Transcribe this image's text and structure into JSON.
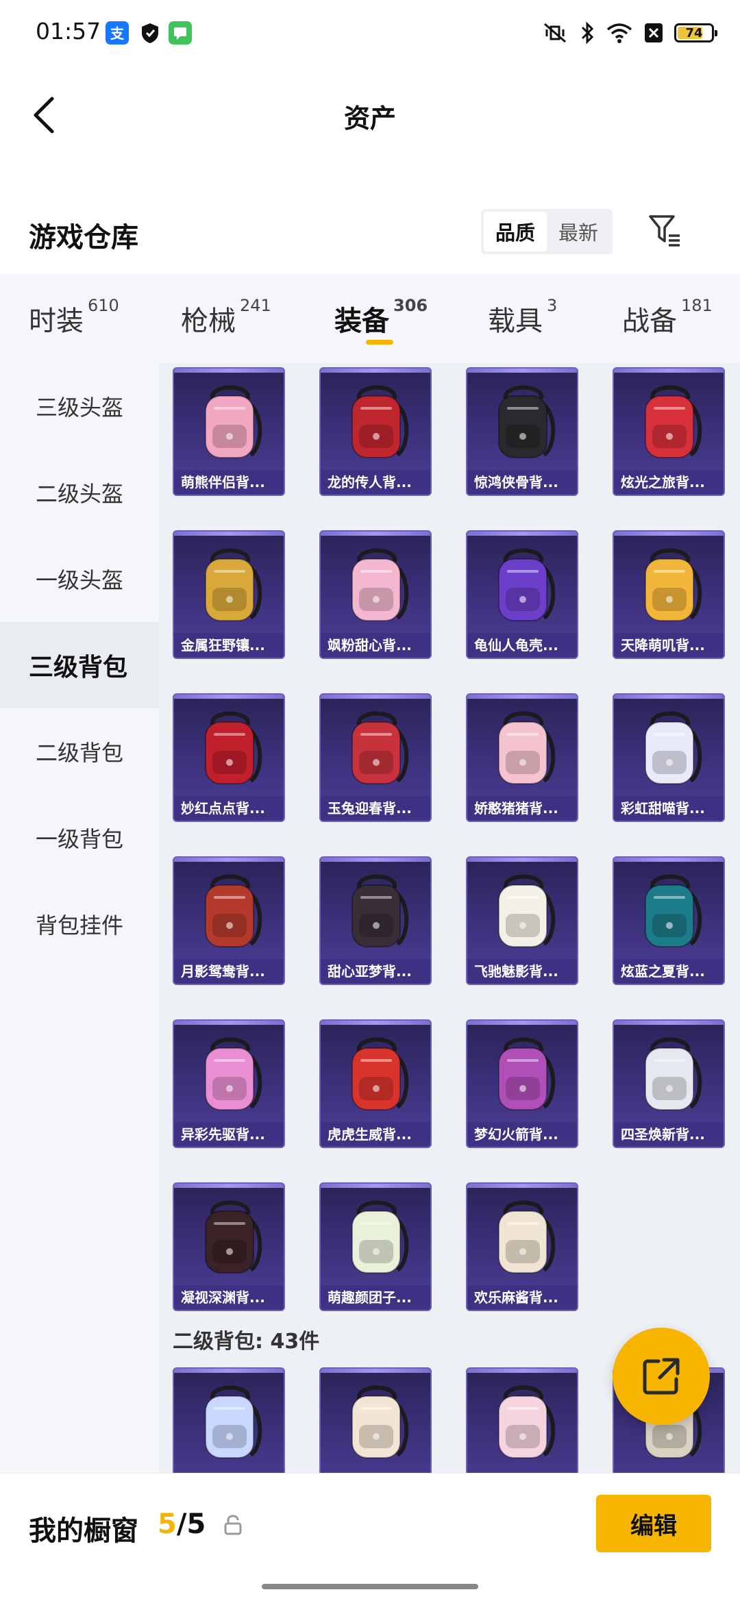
{
  "status_bar": {
    "time": "01:57",
    "battery": "74",
    "battery_level": 0.74
  },
  "header": {
    "title": "资产"
  },
  "warehouse": {
    "title": "游戏仓库",
    "sort_options": [
      "品质",
      "最新"
    ],
    "active_sort": "品质"
  },
  "tabs": [
    {
      "label": "时装",
      "count": "610"
    },
    {
      "label": "枪械",
      "count": "241"
    },
    {
      "label": "装备",
      "count": "306"
    },
    {
      "label": "载具",
      "count": "3"
    },
    {
      "label": "战备",
      "count": "181"
    }
  ],
  "active_tab": "装备",
  "categories": [
    "三级头盔",
    "二级头盔",
    "一级头盔",
    "三级背包",
    "二级背包",
    "一级背包",
    "背包挂件"
  ],
  "active_category": "三级背包",
  "items": [
    {
      "name": "萌熊伴侣背...",
      "icon": "bear-backpack-icon"
    },
    {
      "name": "龙的传人背...",
      "icon": "red-backpack-icon"
    },
    {
      "name": "惊鸿侠骨背...",
      "icon": "black-backpack-icon"
    },
    {
      "name": "炫光之旅背...",
      "icon": "monster-backpack-icon"
    },
    {
      "name": "金属狂野镶...",
      "icon": "gold-wing-backpack-icon"
    },
    {
      "name": "飒粉甜心背...",
      "icon": "pink-backpack-icon"
    },
    {
      "name": "龟仙人龟壳...",
      "icon": "turtle-shell-backpack-icon"
    },
    {
      "name": "天降萌叽背...",
      "icon": "yellow-backpack-icon"
    },
    {
      "name": "妙红点点背...",
      "icon": "red-dot-backpack-icon"
    },
    {
      "name": "玉兔迎春背...",
      "icon": "rabbit-backpack-icon"
    },
    {
      "name": "娇憨猪猪背...",
      "icon": "pig-backpack-icon"
    },
    {
      "name": "彩虹甜喵背...",
      "icon": "cat-backpack-icon"
    },
    {
      "name": "月影鸳鸯背...",
      "icon": "feather-backpack-icon"
    },
    {
      "name": "甜心亚梦背...",
      "icon": "quilted-backpack-icon"
    },
    {
      "name": "飞驰魅影背...",
      "icon": "white-backpack-icon"
    },
    {
      "name": "炫蓝之夏背...",
      "icon": "blue-backpack-icon"
    },
    {
      "name": "异彩先驱背...",
      "icon": "colorful-backpack-icon"
    },
    {
      "name": "虎虎生威背...",
      "icon": "tiger-backpack-icon"
    },
    {
      "name": "梦幻火箭背...",
      "icon": "rocket-backpack-icon"
    },
    {
      "name": "四圣焕新背...",
      "icon": "mask-backpack-icon"
    },
    {
      "name": "凝视深渊背...",
      "icon": "abyss-backpack-icon"
    },
    {
      "name": "萌趣颜团子...",
      "icon": "dumpling-backpack-icon"
    },
    {
      "name": "欢乐麻酱背...",
      "icon": "mahjong-backpack-icon"
    }
  ],
  "item_colors": [
    "#f2a7c3",
    "#c0262e",
    "#2a2a2e",
    "#d8303a",
    "#d9a83a",
    "#f3b7cf",
    "#6b3fc9",
    "#f2b63a",
    "#c11f2c",
    "#c7323c",
    "#f4c3cf",
    "#e8eaf7",
    "#b43a2e",
    "#3a2e36",
    "#f3f1e6",
    "#1c7c8a",
    "#e98ed2",
    "#d9342b",
    "#b04fb7",
    "#e6e8ef",
    "#3b2227",
    "#e9f1da",
    "#f0e5d2"
  ],
  "second_section": {
    "heading": "二级背包: 43件",
    "colors": [
      "#c9d7ff",
      "#f3e5d3",
      "#f6d4df",
      "#d9d2c2"
    ]
  },
  "bottom_bar": {
    "label": "我的橱窗",
    "used": "5",
    "total": "/5",
    "edit": "编辑"
  }
}
